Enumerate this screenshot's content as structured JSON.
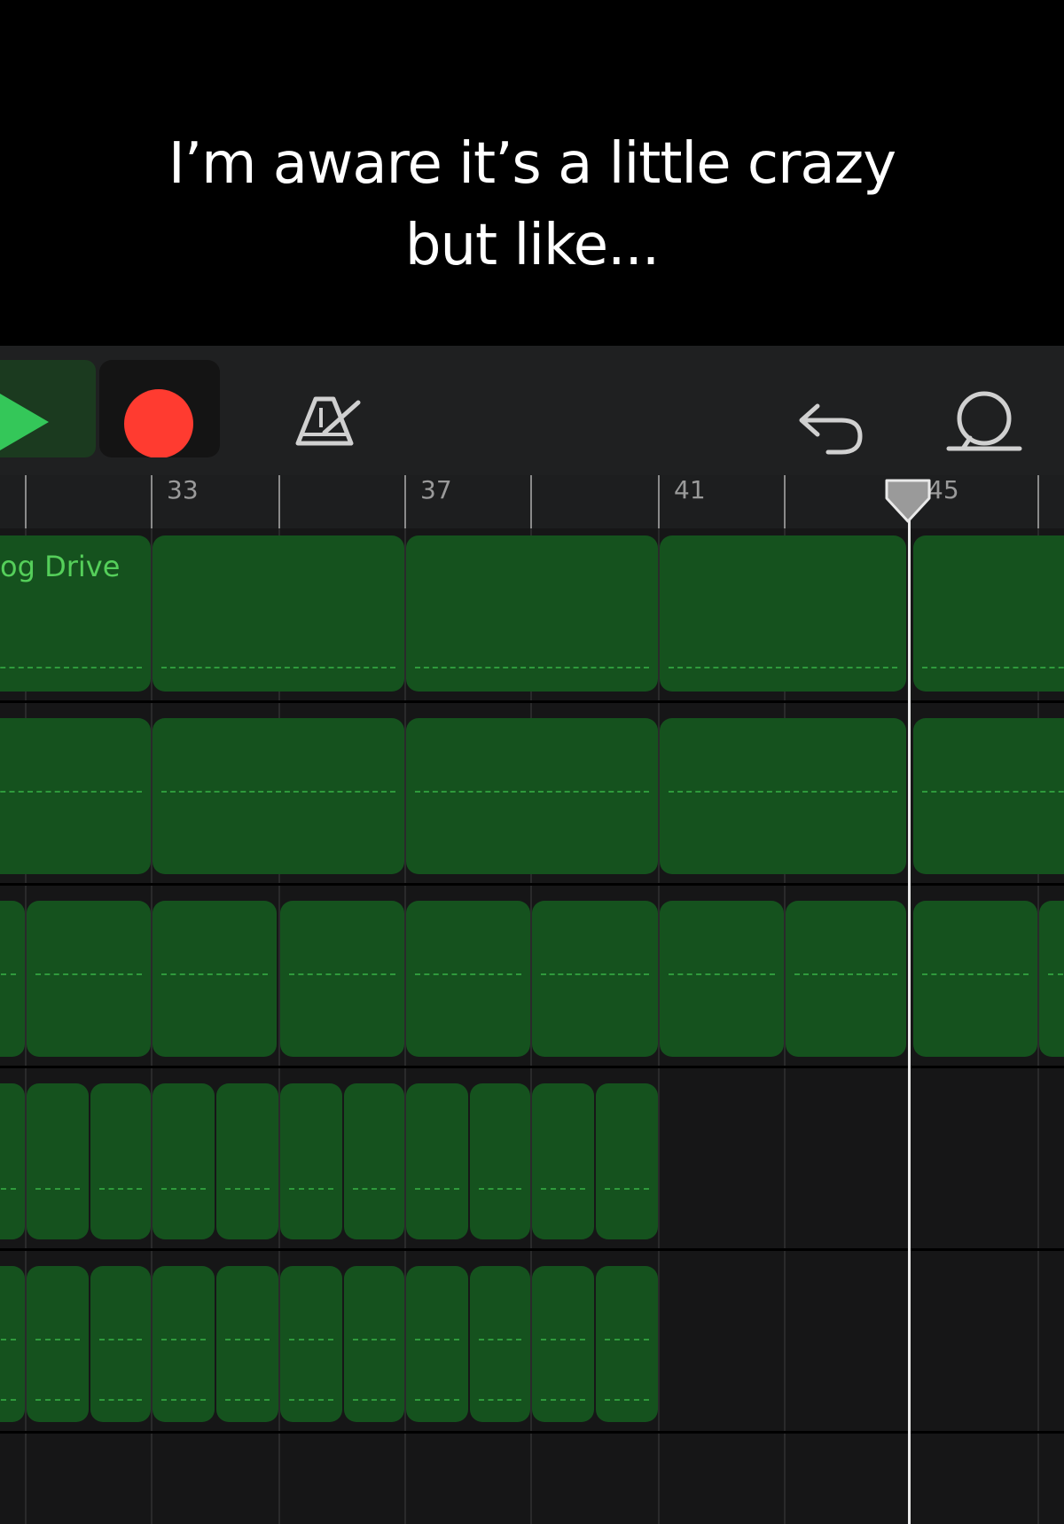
{
  "caption": {
    "line1": "I’m aware it’s a little crazy",
    "line2": "but like..."
  },
  "toolbar": {
    "play_icon": "play-icon",
    "record_icon": "record-icon",
    "metronome_icon": "metronome-icon",
    "undo_icon": "undo-icon",
    "loop_icon": "loop-icon",
    "colors": {
      "play": "#34c759",
      "record": "#ff3b30"
    }
  },
  "ruler": {
    "bars": [
      "33",
      "37",
      "41",
      "45"
    ]
  },
  "tracks": {
    "region_label": "og Drive"
  },
  "colors": {
    "region": "#15521e",
    "region_text": "#55cf5a",
    "playhead": "#e9e9e9"
  }
}
